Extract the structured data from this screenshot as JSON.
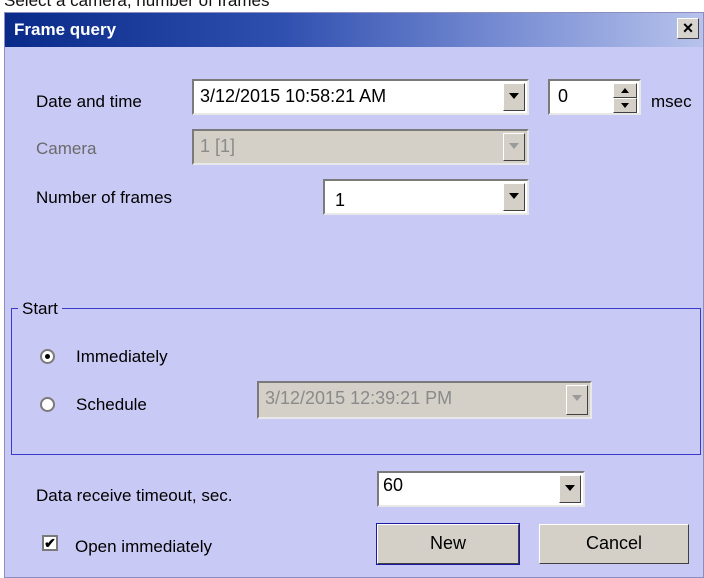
{
  "caption_text": "Select a camera, number of frames",
  "window": {
    "title": "Frame query",
    "close_label": "×"
  },
  "fields": {
    "date_time": {
      "label": "Date and time",
      "value": "3/12/2015 10:58:21 AM"
    },
    "msec": {
      "value": "0",
      "unit": "msec"
    },
    "camera": {
      "label": "Camera",
      "value": "1 [1]",
      "enabled": false
    },
    "frames": {
      "label": "Number of frames",
      "value": "1"
    }
  },
  "start_group": {
    "title": "Start",
    "immediately_label": "Immediately",
    "immediately_selected": true,
    "schedule_label": "Schedule",
    "schedule_value": "3/12/2015 12:39:21 PM",
    "schedule_enabled": false
  },
  "timeout": {
    "label": "Data receive timeout, sec.",
    "value": "60"
  },
  "open_immediately": {
    "label": "Open immediately",
    "checked": true,
    "check_glyph": "✔"
  },
  "buttons": {
    "new": "New",
    "cancel": "Cancel"
  },
  "colors": {
    "window_bg": "#c9c9f5",
    "title_start": "#0a2a8a",
    "title_end": "#b7c3ec",
    "group_border": "#3a3acc"
  }
}
